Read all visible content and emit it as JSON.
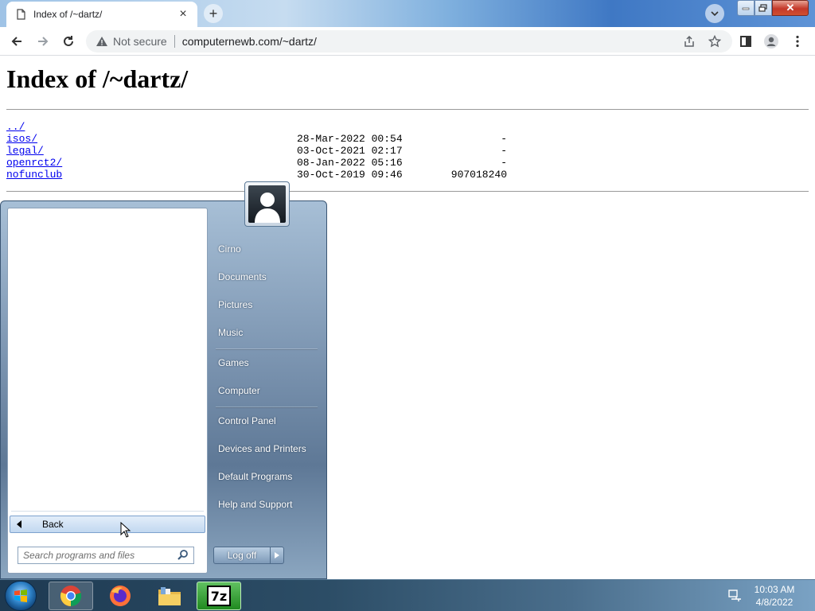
{
  "browser": {
    "tab_title": "Index of /~dartz/",
    "not_secure": "Not secure",
    "url": "computernewb.com/~dartz/"
  },
  "page": {
    "heading": "Index of /~dartz/",
    "entries": [
      {
        "name": "../",
        "date": "",
        "size": ""
      },
      {
        "name": "isos/",
        "date": "28-Mar-2022 00:54",
        "size": "-"
      },
      {
        "name": "legal/",
        "date": "03-Oct-2021 02:17",
        "size": "-"
      },
      {
        "name": "openrct2/",
        "date": "08-Jan-2022 05:16",
        "size": "-"
      },
      {
        "name": "nofunclub",
        "date": "30-Oct-2019 09:46",
        "size": "907018240"
      }
    ]
  },
  "start_menu": {
    "back_label": "Back",
    "search_placeholder": "Search programs and files",
    "right_items": [
      "Cirno",
      "Documents",
      "Pictures",
      "Music",
      "Games",
      "Computer",
      "Control Panel",
      "Devices and Printers",
      "Default Programs",
      "Help and Support"
    ],
    "logoff_label": "Log off"
  },
  "taskbar": {
    "apps": [
      "chrome-icon",
      "firefox-icon",
      "explorer-icon",
      "7zip-icon"
    ],
    "seven_zip_label": "7z",
    "time": "10:03 AM",
    "date": "4/8/2022"
  }
}
